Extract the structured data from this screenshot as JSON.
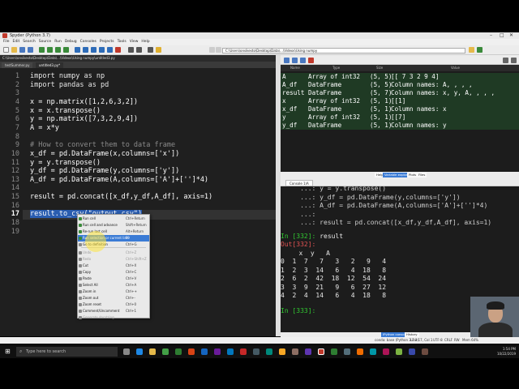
{
  "window": {
    "title": "Spyder (Python 3.7)"
  },
  "menubar": [
    "File",
    "Edit",
    "Search",
    "Source",
    "Run",
    "Debug",
    "Consoles",
    "Projects",
    "Tools",
    "View",
    "Help"
  ],
  "toolbar": {
    "path": "C:\\Users\\onsikesto\\Desktop\\Data\\...\\Videos\\Using numpy"
  },
  "editor": {
    "path": "C:\\Users\\onsikesto\\Desktop\\Data\\...\\Videos\\Using numpy\\untitled3.py",
    "tabs": [
      "testSummer.py",
      "untitled3.py*"
    ],
    "lines": [
      "import numpy as np",
      "import pandas as pd",
      "",
      "x = np.matrix([1,2,6,3,2])",
      "x = x.transpose()",
      "y = np.matrix([7,3,2,9,4])",
      "A = x*y",
      "",
      "# How to convert them to data frame",
      "x_df = pd.DataFrame(x,columns=['x'])",
      "y = y.transpose()",
      "y_df = pd.DataFrame(y,columns=['y'])",
      "A_df = pd.DataFrame(A,columns=['A']+['']*4)",
      "",
      "result = pd.concat([x_df,y_df,A_df], axis=1)",
      "",
      "result.to_csv(\"output.csv\")",
      "",
      ""
    ],
    "line_numbers": [
      "1",
      "2",
      "3",
      "4",
      "5",
      "6",
      "7",
      "8",
      "9",
      "10",
      "11",
      "12",
      "13",
      "14",
      "15",
      "16",
      "17",
      "18",
      "19"
    ],
    "current_line": "17"
  },
  "context_menu": {
    "items": [
      {
        "label": "Run cell",
        "shortcut": "Ctrl+Return"
      },
      {
        "label": "Run cell and advance",
        "shortcut": "Shift+Return"
      },
      {
        "label": "Re-run last cell",
        "shortcut": "Alt+Return"
      },
      {
        "label": "Run selection or current line",
        "shortcut": "F9"
      },
      {
        "label": "Go to definition",
        "shortcut": "Ctrl+G"
      },
      {
        "label": "Undo",
        "shortcut": "Ctrl+Z"
      },
      {
        "label": "Redo",
        "shortcut": "Ctrl+Shift+Z"
      },
      {
        "label": "Cut",
        "shortcut": "Ctrl+X"
      },
      {
        "label": "Copy",
        "shortcut": "Ctrl+C"
      },
      {
        "label": "Paste",
        "shortcut": "Ctrl+V"
      },
      {
        "label": "Select All",
        "shortcut": "Ctrl+A"
      },
      {
        "label": "Zoom in",
        "shortcut": "Ctrl++"
      },
      {
        "label": "Zoom out",
        "shortcut": "Ctrl+-"
      },
      {
        "label": "Zoom reset",
        "shortcut": "Ctrl+0"
      },
      {
        "label": "Comment/Uncomment",
        "shortcut": "Ctrl+1"
      },
      {
        "label": "Generate docstring",
        "shortcut": ""
      }
    ],
    "highlighted": "Run selection or current line"
  },
  "variable_explorer": {
    "headers": [
      "Name",
      "Type",
      "Size",
      "Value"
    ],
    "rows": [
      {
        "name": "A",
        "type": "Array of int32",
        "size": "(5, 5)",
        "value": "[[ 7  3  2  9  4]"
      },
      {
        "name": "A_df",
        "type": "DataFrame",
        "size": "(5, 5)",
        "value": "Column names: A, , , ,"
      },
      {
        "name": "result",
        "type": "DataFrame",
        "size": "(5, 7)",
        "value": "Column names: x, y, A, , , ,"
      },
      {
        "name": "x",
        "type": "Array of int32",
        "size": "(5, 1)",
        "value": "[[1]"
      },
      {
        "name": "x_df",
        "type": "DataFrame",
        "size": "(5, 1)",
        "value": "Column names: x"
      },
      {
        "name": "y",
        "type": "Array of int32",
        "size": "(5, 1)",
        "value": "[[7]"
      },
      {
        "name": "y_df",
        "type": "DataFrame",
        "size": "(5, 1)",
        "value": "Column names: y"
      }
    ],
    "tabs": [
      "Help",
      "Variable explorer",
      "Plots",
      "Files"
    ],
    "active_tab": "Variable explorer"
  },
  "console": {
    "tab": "Console 1/A",
    "lines": [
      "     ...: y = y.transpose()",
      "     ...: y_df = pd.DataFrame(y,columns=['y'])",
      "     ...: A_df = pd.DataFrame(A,columns=['A']+['']*4)",
      "     ...:",
      "     ...: result = pd.concat([x_df,y_df,A_df], axis=1)"
    ],
    "in_prompt_1": "In [332]:",
    "in_cmd_1": "result",
    "out_prompt": "Out[332]:",
    "table_header": "   x  y   A",
    "table_rows": [
      "0  1  7   7   3   2   9   4",
      "1  2  3  14   6   4  18   8",
      "2  6  2  42  18  12  54  24",
      "3  3  9  21   9   6  27  12",
      "4  2  4  14   6   4  18   8"
    ],
    "in_prompt_2": "In [333]:",
    "bottom_tabs": [
      "IPython console",
      "History"
    ],
    "active_bottom_tab": "IPython console"
  },
  "statusbar": {
    "items": [
      "conda: base (Python 3.7.3)",
      "Line 17, Col 1",
      "UTF-8",
      "CRLF",
      "RW",
      "Mem 64%"
    ]
  },
  "taskbar": {
    "search_placeholder": "Type here to search",
    "time": "1:54 PM",
    "date": "10/22/2019"
  },
  "colors": {
    "accent": "#3a7bd5",
    "prompt": "#31c831",
    "out_prompt": "#e05252",
    "var_row_bg": "#1f3a24"
  }
}
